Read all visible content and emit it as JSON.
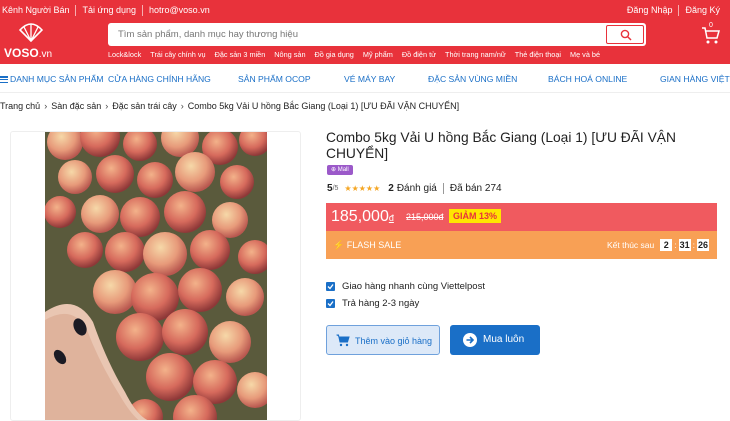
{
  "header": {
    "top_links": [
      "Kênh Người Bán",
      "Tải ứng dụng",
      "hotro@voso.vn"
    ],
    "auth": {
      "login": "Đăng Nhập",
      "register": "Đăng Ký"
    },
    "logo_text": "VOSO",
    "logo_suffix": ".vn",
    "search_placeholder": "Tìm sản phẩm, danh mục hay thương hiệu",
    "quick_links": [
      "Lock&lock",
      "Trái cây chính vụ",
      "Đặc sản 3 miền",
      "Nông sản",
      "Đồ gia dụng",
      "Mỹ phẩm",
      "Đồ điện tử",
      "Thời trang nam/nữ",
      "Thẻ điện thoại",
      "Mẹ và bé"
    ],
    "cart_count": "0",
    "brand_color": "#e8323b"
  },
  "nav": {
    "items": [
      "DANH MỤC SẢN PHẨM",
      "CỬA HÀNG CHÍNH HÃNG",
      "SẢN PHẨM OCOP",
      "VÉ MÁY BAY",
      "ĐẶC SẢN VÙNG MIỀN",
      "BÁCH HOÁ ONLINE",
      "GIAN HÀNG VIỆT"
    ]
  },
  "breadcrumb": [
    "Trang chủ",
    "Sàn đặc sản",
    "Đặc sản trái cây",
    "Combo 5kg Vải U hồng Bắc Giang (Loại 1) [ƯU ĐÃI VẬN CHUYỂN]"
  ],
  "product": {
    "title": "Combo 5kg Vải U hồng Bắc Giang (Loại 1) [ƯU ĐÃI VẬN CHUYỂN]",
    "badge": "Mall",
    "score": "5",
    "score_max": "/5",
    "stars": 5,
    "review_count": "2",
    "review_label": "Đánh giá",
    "sold": "Đã bán 274",
    "price": "185,000",
    "currency": "đ",
    "old_price": "215,000đ",
    "discount": "GIẢM 13%",
    "flash_label": "FLASH SALE",
    "countdown_label": "Kết thúc sau",
    "countdown": [
      "2",
      "31",
      "26"
    ],
    "options": [
      "Giao hàng nhanh cùng Viettelpost",
      "Trả hàng 2-3 ngày"
    ],
    "add_to_cart": "Thêm vào giỏ hàng",
    "buy_now": "Mua luôn"
  }
}
